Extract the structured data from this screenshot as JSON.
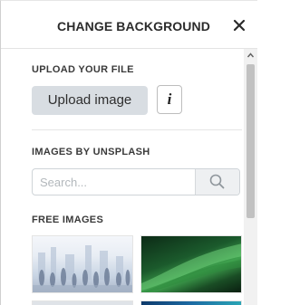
{
  "header": {
    "title": "CHANGE BACKGROUND",
    "close_icon": "close-icon"
  },
  "upload": {
    "label": "UPLOAD YOUR FILE",
    "button_label": "Upload image",
    "info_label": "i"
  },
  "unsplash": {
    "label": "IMAGES BY UNSPLASH",
    "search_placeholder": "Search...",
    "search_value": "",
    "search_icon": "search-icon"
  },
  "free_images": {
    "label": "FREE IMAGES",
    "thumbnails": [
      {
        "name": "free-image-crowd-city"
      },
      {
        "name": "free-image-green-abstract"
      },
      {
        "name": "free-image-3"
      },
      {
        "name": "free-image-4"
      }
    ]
  },
  "colors": {
    "upload_button_bg": "#d8dde2",
    "search_button_bg": "#eef0f2",
    "text": "#2b2b2b"
  }
}
